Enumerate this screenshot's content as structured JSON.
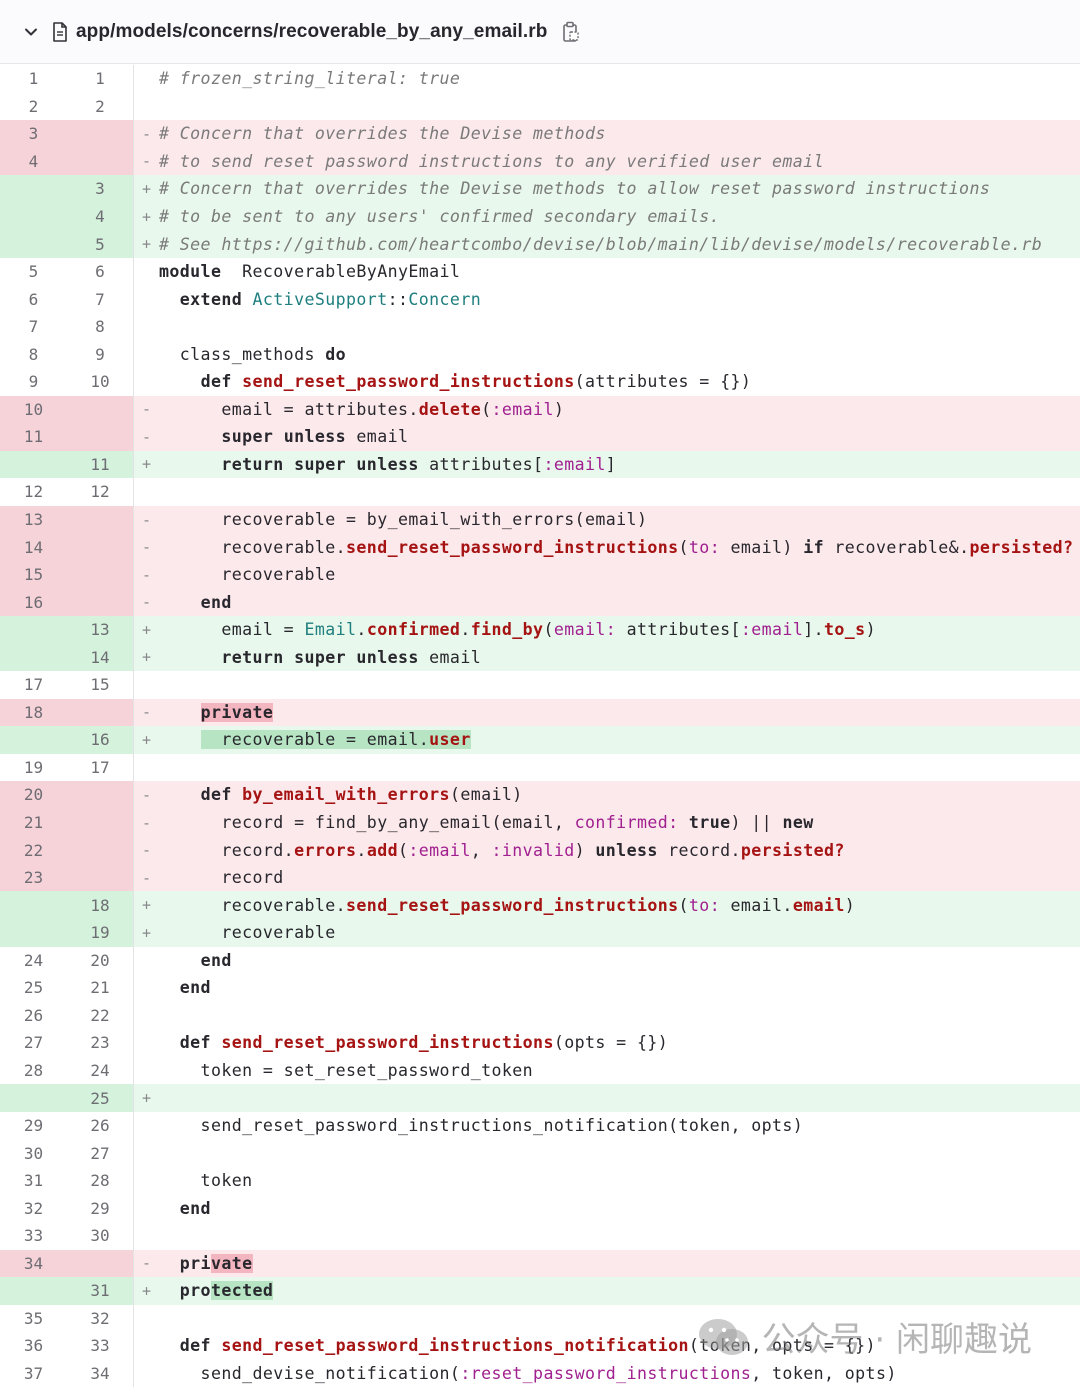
{
  "header": {
    "file_path": "app/models/concerns/recoverable_by_any_email.rb"
  },
  "watermark": {
    "text": "公众号 · 闲聊趣说"
  },
  "diff_lines": [
    {
      "type": "ctx",
      "old": "1",
      "new": "1",
      "marker": "",
      "tokens": [
        [
          "c",
          "# frozen_string_literal: true"
        ]
      ]
    },
    {
      "type": "ctx",
      "old": "2",
      "new": "2",
      "marker": "",
      "tokens": []
    },
    {
      "type": "del",
      "old": "3",
      "new": "",
      "marker": "-",
      "tokens": [
        [
          "c",
          "# Concern that overrides the Devise methods"
        ]
      ]
    },
    {
      "type": "del",
      "old": "4",
      "new": "",
      "marker": "-",
      "tokens": [
        [
          "c",
          "# to send reset password instructions to any verified user email"
        ]
      ]
    },
    {
      "type": "add",
      "old": "",
      "new": "3",
      "marker": "+",
      "tokens": [
        [
          "c",
          "# Concern that overrides the Devise methods to allow reset password instructions"
        ]
      ]
    },
    {
      "type": "add",
      "old": "",
      "new": "4",
      "marker": "+",
      "tokens": [
        [
          "c",
          "# to be sent to any users' confirmed secondary emails."
        ]
      ]
    },
    {
      "type": "add",
      "old": "",
      "new": "5",
      "marker": "+",
      "tokens": [
        [
          "c",
          "# See https://github.com/heartcombo/devise/blob/main/lib/devise/models/recoverable.rb"
        ]
      ]
    },
    {
      "type": "ctx",
      "old": "5",
      "new": "6",
      "marker": "",
      "tokens": [
        [
          "k",
          "module"
        ],
        [
          "",
          "  RecoverableByAnyEmail"
        ]
      ]
    },
    {
      "type": "ctx",
      "old": "6",
      "new": "7",
      "marker": "",
      "tokens": [
        [
          "",
          "  "
        ],
        [
          "k",
          "extend"
        ],
        [
          "",
          " "
        ],
        [
          "t",
          "ActiveSupport"
        ],
        [
          "",
          "::"
        ],
        [
          "t",
          "Concern"
        ]
      ]
    },
    {
      "type": "ctx",
      "old": "7",
      "new": "8",
      "marker": "",
      "tokens": []
    },
    {
      "type": "ctx",
      "old": "8",
      "new": "9",
      "marker": "",
      "tokens": [
        [
          "",
          "  class_methods "
        ],
        [
          "k",
          "do"
        ]
      ]
    },
    {
      "type": "ctx",
      "old": "9",
      "new": "10",
      "marker": "",
      "tokens": [
        [
          "",
          "    "
        ],
        [
          "k",
          "def"
        ],
        [
          "",
          " "
        ],
        [
          "f",
          "send_reset_password_instructions"
        ],
        [
          "",
          "(attributes = {})"
        ]
      ]
    },
    {
      "type": "del",
      "old": "10",
      "new": "",
      "marker": "-",
      "tokens": [
        [
          "",
          "      email = attributes."
        ],
        [
          "f",
          "delete"
        ],
        [
          "",
          "("
        ],
        [
          "s",
          ":email"
        ],
        [
          "",
          ")"
        ]
      ]
    },
    {
      "type": "del",
      "old": "11",
      "new": "",
      "marker": "-",
      "tokens": [
        [
          "",
          "      "
        ],
        [
          "k",
          "super"
        ],
        [
          "",
          " "
        ],
        [
          "k",
          "unless"
        ],
        [
          "",
          " email"
        ]
      ]
    },
    {
      "type": "add",
      "old": "",
      "new": "11",
      "marker": "+",
      "tokens": [
        [
          "",
          "      "
        ],
        [
          "k",
          "return"
        ],
        [
          "",
          " "
        ],
        [
          "k",
          "super"
        ],
        [
          "",
          " "
        ],
        [
          "k",
          "unless"
        ],
        [
          "",
          " attributes["
        ],
        [
          "s",
          ":email"
        ],
        [
          "",
          "]"
        ]
      ]
    },
    {
      "type": "ctx",
      "old": "12",
      "new": "12",
      "marker": "",
      "tokens": []
    },
    {
      "type": "del",
      "old": "13",
      "new": "",
      "marker": "-",
      "tokens": [
        [
          "",
          "      recoverable = by_email_with_errors(email)"
        ]
      ]
    },
    {
      "type": "del",
      "old": "14",
      "new": "",
      "marker": "-",
      "tokens": [
        [
          "",
          "      recoverable."
        ],
        [
          "f",
          "send_reset_password_instructions"
        ],
        [
          "",
          "("
        ],
        [
          "s",
          "to:"
        ],
        [
          "",
          " email) "
        ],
        [
          "k",
          "if"
        ],
        [
          "",
          " recoverable&."
        ],
        [
          "f",
          "persisted?"
        ]
      ]
    },
    {
      "type": "del",
      "old": "15",
      "new": "",
      "marker": "-",
      "tokens": [
        [
          "",
          "      recoverable"
        ]
      ]
    },
    {
      "type": "del",
      "old": "16",
      "new": "",
      "marker": "-",
      "tokens": [
        [
          "",
          "    "
        ],
        [
          "k",
          "end"
        ]
      ]
    },
    {
      "type": "add",
      "old": "",
      "new": "13",
      "marker": "+",
      "tokens": [
        [
          "",
          "      email = "
        ],
        [
          "t",
          "Email"
        ],
        [
          "",
          "."
        ],
        [
          "f",
          "confirmed"
        ],
        [
          "",
          "."
        ],
        [
          "f",
          "find_by"
        ],
        [
          "",
          "("
        ],
        [
          "s",
          "email:"
        ],
        [
          "",
          " attributes["
        ],
        [
          "s",
          ":email"
        ],
        [
          "",
          "]."
        ],
        [
          "f",
          "to_s"
        ],
        [
          "",
          ")"
        ]
      ]
    },
    {
      "type": "add",
      "old": "",
      "new": "14",
      "marker": "+",
      "tokens": [
        [
          "",
          "      "
        ],
        [
          "k",
          "return"
        ],
        [
          "",
          " "
        ],
        [
          "k",
          "super"
        ],
        [
          "",
          " "
        ],
        [
          "k",
          "unless"
        ],
        [
          "",
          " email"
        ]
      ]
    },
    {
      "type": "ctx",
      "old": "17",
      "new": "15",
      "marker": "",
      "tokens": []
    },
    {
      "type": "del",
      "old": "18",
      "new": "",
      "marker": "-",
      "tokens": [
        [
          "",
          "    "
        ],
        [
          "hl-del k",
          "private"
        ]
      ]
    },
    {
      "type": "add",
      "old": "",
      "new": "16",
      "marker": "+",
      "tokens": [
        [
          "",
          "    "
        ],
        [
          "hl-add",
          "  recoverable = email."
        ],
        [
          "hl-add f",
          "user"
        ]
      ]
    },
    {
      "type": "ctx",
      "old": "19",
      "new": "17",
      "marker": "",
      "tokens": []
    },
    {
      "type": "del",
      "old": "20",
      "new": "",
      "marker": "-",
      "tokens": [
        [
          "",
          "    "
        ],
        [
          "k",
          "def"
        ],
        [
          "",
          " "
        ],
        [
          "f",
          "by_email_with_errors"
        ],
        [
          "",
          "(email)"
        ]
      ]
    },
    {
      "type": "del",
      "old": "21",
      "new": "",
      "marker": "-",
      "tokens": [
        [
          "",
          "      record = find_by_any_email(email, "
        ],
        [
          "s",
          "confirmed:"
        ],
        [
          "",
          " "
        ],
        [
          "k",
          "true"
        ],
        [
          "",
          ") || "
        ],
        [
          "k",
          "new"
        ]
      ]
    },
    {
      "type": "del",
      "old": "22",
      "new": "",
      "marker": "-",
      "tokens": [
        [
          "",
          "      record."
        ],
        [
          "f",
          "errors"
        ],
        [
          "",
          "."
        ],
        [
          "f",
          "add"
        ],
        [
          "",
          "("
        ],
        [
          "s",
          ":email"
        ],
        [
          "",
          ", "
        ],
        [
          "s",
          ":invalid"
        ],
        [
          "",
          ") "
        ],
        [
          "k",
          "unless"
        ],
        [
          "",
          " record."
        ],
        [
          "f",
          "persisted?"
        ]
      ]
    },
    {
      "type": "del",
      "old": "23",
      "new": "",
      "marker": "-",
      "tokens": [
        [
          "",
          "      record"
        ]
      ]
    },
    {
      "type": "add",
      "old": "",
      "new": "18",
      "marker": "+",
      "tokens": [
        [
          "",
          "      recoverable."
        ],
        [
          "f",
          "send_reset_password_instructions"
        ],
        [
          "",
          "("
        ],
        [
          "s",
          "to:"
        ],
        [
          "",
          " email."
        ],
        [
          "f",
          "email"
        ],
        [
          "",
          ")"
        ]
      ]
    },
    {
      "type": "add",
      "old": "",
      "new": "19",
      "marker": "+",
      "tokens": [
        [
          "",
          "      recoverable"
        ]
      ]
    },
    {
      "type": "ctx",
      "old": "24",
      "new": "20",
      "marker": "",
      "tokens": [
        [
          "",
          "    "
        ],
        [
          "k",
          "end"
        ]
      ]
    },
    {
      "type": "ctx",
      "old": "25",
      "new": "21",
      "marker": "",
      "tokens": [
        [
          "",
          "  "
        ],
        [
          "k",
          "end"
        ]
      ]
    },
    {
      "type": "ctx",
      "old": "26",
      "new": "22",
      "marker": "",
      "tokens": []
    },
    {
      "type": "ctx",
      "old": "27",
      "new": "23",
      "marker": "",
      "tokens": [
        [
          "",
          "  "
        ],
        [
          "k",
          "def"
        ],
        [
          "",
          " "
        ],
        [
          "f",
          "send_reset_password_instructions"
        ],
        [
          "",
          "(opts = {})"
        ]
      ]
    },
    {
      "type": "ctx",
      "old": "28",
      "new": "24",
      "marker": "",
      "tokens": [
        [
          "",
          "    token = set_reset_password_token"
        ]
      ]
    },
    {
      "type": "add",
      "old": "",
      "new": "25",
      "marker": "+",
      "tokens": []
    },
    {
      "type": "ctx",
      "old": "29",
      "new": "26",
      "marker": "",
      "tokens": [
        [
          "",
          "    send_reset_password_instructions_notification(token, opts)"
        ]
      ]
    },
    {
      "type": "ctx",
      "old": "30",
      "new": "27",
      "marker": "",
      "tokens": []
    },
    {
      "type": "ctx",
      "old": "31",
      "new": "28",
      "marker": "",
      "tokens": [
        [
          "",
          "    token"
        ]
      ]
    },
    {
      "type": "ctx",
      "old": "32",
      "new": "29",
      "marker": "",
      "tokens": [
        [
          "",
          "  "
        ],
        [
          "k",
          "end"
        ]
      ]
    },
    {
      "type": "ctx",
      "old": "33",
      "new": "30",
      "marker": "",
      "tokens": []
    },
    {
      "type": "del",
      "old": "34",
      "new": "",
      "marker": "-",
      "tokens": [
        [
          "",
          "  "
        ],
        [
          "k",
          "pri"
        ],
        [
          "hl-del k",
          "vate"
        ]
      ]
    },
    {
      "type": "add",
      "old": "",
      "new": "31",
      "marker": "+",
      "tokens": [
        [
          "",
          "  "
        ],
        [
          "k",
          "pro"
        ],
        [
          "hl-add k",
          "tected"
        ]
      ]
    },
    {
      "type": "ctx",
      "old": "35",
      "new": "32",
      "marker": "",
      "tokens": []
    },
    {
      "type": "ctx",
      "old": "36",
      "new": "33",
      "marker": "",
      "tokens": [
        [
          "",
          "  "
        ],
        [
          "k",
          "def"
        ],
        [
          "",
          " "
        ],
        [
          "f",
          "send_reset_password_instructions_notification"
        ],
        [
          "",
          "(token, opts = {})"
        ]
      ]
    },
    {
      "type": "ctx",
      "old": "37",
      "new": "34",
      "marker": "",
      "tokens": [
        [
          "",
          "    send_devise_notification("
        ],
        [
          "s",
          ":reset_password_instructions"
        ],
        [
          "",
          ", token, opts)"
        ]
      ]
    }
  ]
}
